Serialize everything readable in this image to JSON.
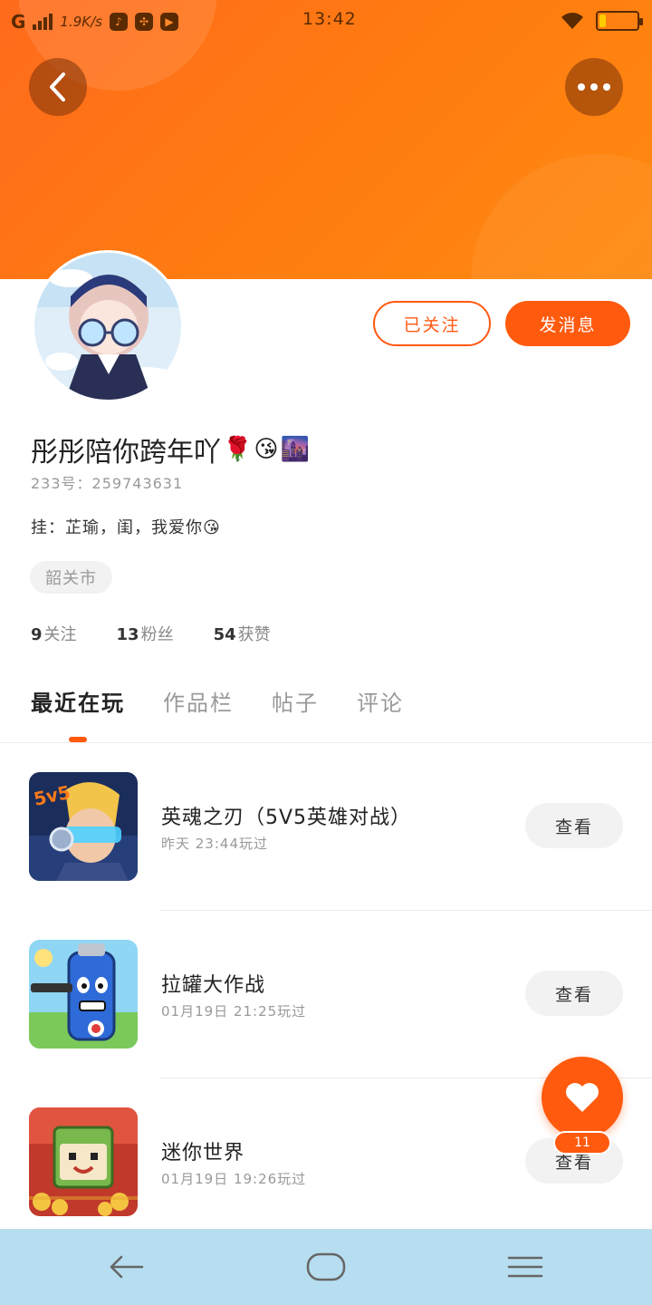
{
  "status_bar": {
    "network": "G",
    "speed": "1.9K/s",
    "time": "13:42"
  },
  "header": {
    "back_icon": "chevron-left-icon",
    "more_icon": "more-dots-icon"
  },
  "profile": {
    "username": "彤彤陪你跨年吖",
    "username_emojis": [
      "🌹",
      "😘",
      "🌆"
    ],
    "uid": "233号：259743631",
    "bio": "挂：芷瑜，闺，我爱你😘",
    "location": "韶关市",
    "followed_label": "已关注",
    "message_label": "发消息"
  },
  "stats": [
    {
      "num": "9",
      "label": "关注"
    },
    {
      "num": "13",
      "label": "粉丝"
    },
    {
      "num": "54",
      "label": "获赞"
    }
  ],
  "tabs": [
    {
      "label": "最近在玩",
      "active": true
    },
    {
      "label": "作品栏",
      "active": false
    },
    {
      "label": "帖子",
      "active": false
    },
    {
      "label": "评论",
      "active": false
    }
  ],
  "games": [
    {
      "name": "英魂之刃（5V5英雄对战）",
      "time": "昨天 23:44玩过",
      "button": "查看"
    },
    {
      "name": "拉罐大作战",
      "time": "01月19日 21:25玩过",
      "button": "查看"
    },
    {
      "name": "迷你世界",
      "time": "01月19日 19:26玩过",
      "button": "查看"
    }
  ],
  "like": {
    "icon": "heart-icon",
    "count": "11"
  },
  "nav": {
    "back_icon": "back-arrow-icon",
    "home_icon": "home-pill-icon",
    "menu_icon": "menu-lines-icon"
  },
  "colors": {
    "accent": "#ff5a0e",
    "header_start": "#ff6a1c",
    "header_end": "#ff8a0f",
    "nav_bg": "#b6def0"
  }
}
